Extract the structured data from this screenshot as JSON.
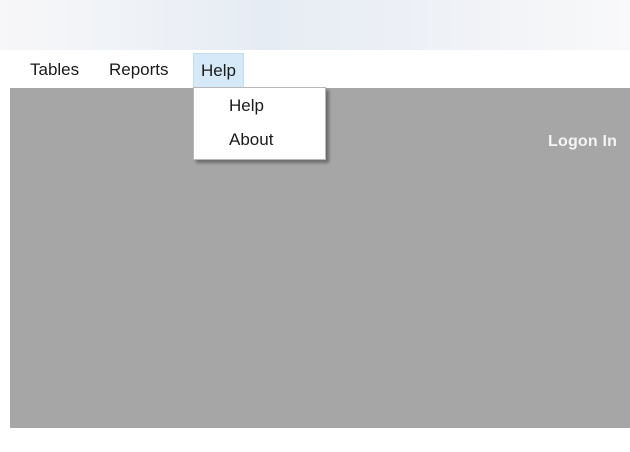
{
  "menubar": {
    "items": [
      {
        "label": "Tables"
      },
      {
        "label": "Reports"
      },
      {
        "label": "Help"
      }
    ]
  },
  "help_menu": {
    "items": [
      {
        "label": "Help"
      },
      {
        "label": "About"
      }
    ]
  },
  "content": {
    "logon_label": "Logon In"
  },
  "colors": {
    "content_background": "#a6a6a6",
    "menu_highlight": "#d6e9f8",
    "logon_text": "#f4f4f4"
  }
}
